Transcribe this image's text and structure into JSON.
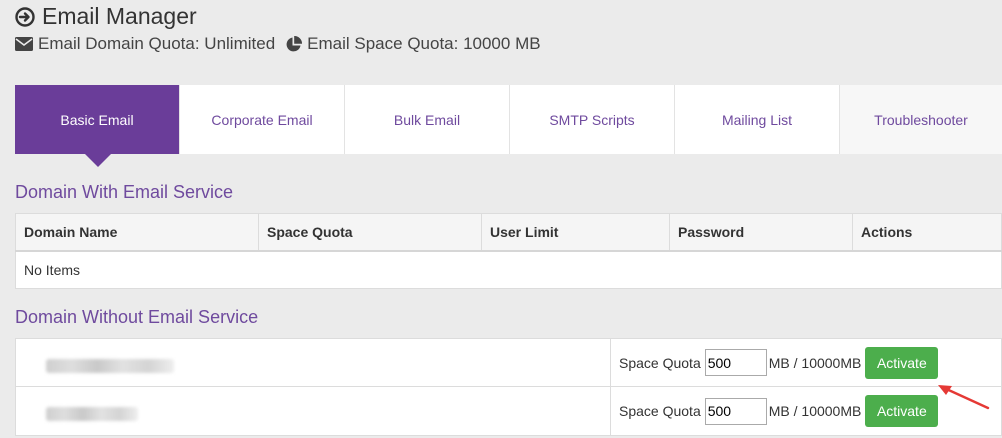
{
  "header": {
    "title": "Email Manager",
    "title_icon": "circle-arrow-right-icon",
    "domain_quota": "Email Domain Quota: Unlimited",
    "domain_quota_icon": "envelope-icon",
    "space_quota": "Email Space Quota: 10000 MB",
    "space_quota_icon": "pie-chart-icon"
  },
  "tabs": [
    {
      "label": "Basic Email",
      "active": true
    },
    {
      "label": "Corporate Email"
    },
    {
      "label": "Bulk Email"
    },
    {
      "label": "SMTP Scripts"
    },
    {
      "label": "Mailing List"
    },
    {
      "label": "Troubleshooter"
    }
  ],
  "with_service": {
    "title": "Domain With Email Service",
    "columns": [
      "Domain Name",
      "Space Quota",
      "User Limit",
      "Password",
      "Actions"
    ],
    "empty_text": "No Items"
  },
  "without_service": {
    "title": "Domain Without Email Service",
    "rows": [
      {
        "quota_label": "Space Quota",
        "quota_value": "500",
        "quota_suffix": "MB / 10000MB",
        "button": "Activate"
      },
      {
        "quota_label": "Space Quota",
        "quota_value": "500",
        "quota_suffix": "MB / 10000MB",
        "button": "Activate"
      }
    ]
  },
  "colors": {
    "accent": "#6a3d99",
    "link": "#6f4a9e",
    "button": "#4cae4c",
    "annotation_arrow": "#e53935"
  }
}
